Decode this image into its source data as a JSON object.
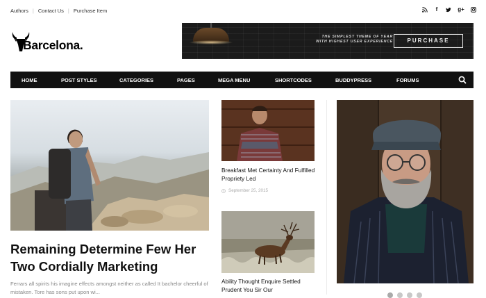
{
  "topbar": {
    "links": [
      "Authors",
      "Contact Us",
      "Purchase Item"
    ],
    "social_icons": [
      "rss-icon",
      "facebook-icon",
      "twitter-icon",
      "googleplus-icon",
      "instagram-icon"
    ]
  },
  "logo": {
    "text": "Barcelona."
  },
  "banner": {
    "tagline_line1": "THE SIMPLEST THEME OF YEAR",
    "tagline_line2": "WITH HIGHEST USER EXPERIENCE",
    "button_label": "PURCHASE"
  },
  "nav": {
    "items": [
      "HOME",
      "POST STYLES",
      "CATEGORIES",
      "PAGES",
      "MEGA MENU",
      "SHORTCODES",
      "BUDDYPRESS",
      "FORUMS"
    ],
    "search_icon": "search-icon"
  },
  "featured": {
    "title": "Remaining Determine Few Her Two Cordially Marketing",
    "excerpt": "Ferrars all spirits his imagine effects amongst neither as called It bachelor cheerful of mistaken. Tore has sons put upon wi..."
  },
  "posts": [
    {
      "title": "Breakfast Met Certainty And Fulfilled Propriety Led",
      "date": "September 25, 2015"
    },
    {
      "title": "Ability Thought Enquire Settled Prudent You Sir Our"
    }
  ],
  "slider": {
    "dot_count": 4,
    "active_index": 0
  },
  "colors": {
    "nav_bg": "#111111",
    "text": "#111111",
    "muted": "#888888"
  }
}
